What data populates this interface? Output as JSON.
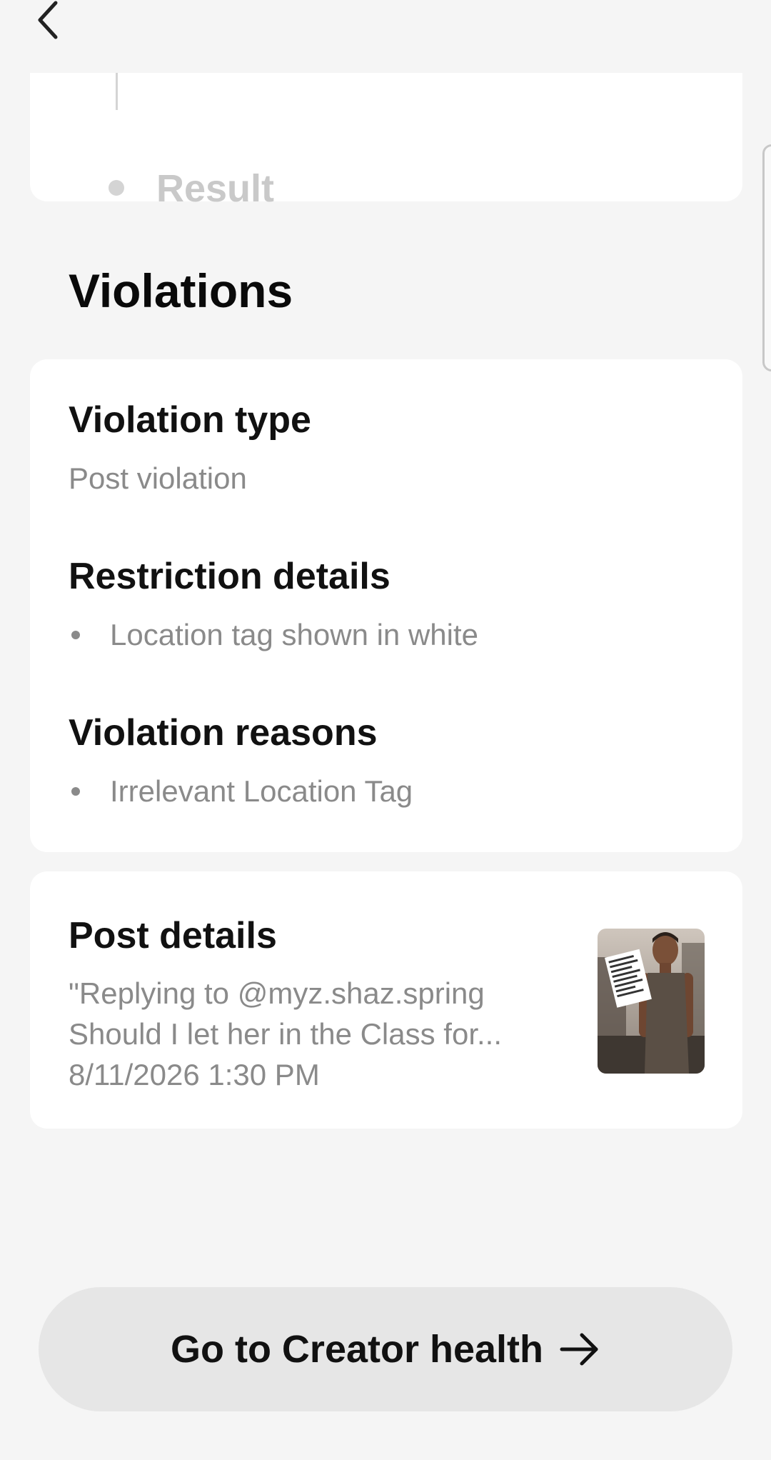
{
  "header": {
    "back_icon": "chevron-left-icon"
  },
  "progress": {
    "step_label": "Result"
  },
  "section": {
    "title": "Violations"
  },
  "violation": {
    "type_label": "Violation type",
    "type_value": "Post violation",
    "restriction_label": "Restriction details",
    "restriction_items": [
      "Location tag shown in white"
    ],
    "reasons_label": "Violation reasons",
    "reason_items": [
      "Irrelevant Location Tag"
    ]
  },
  "post": {
    "title": "Post details",
    "caption_line1": "\"Replying to @myz.shaz.spring",
    "caption_line2": "Should I let her in the Class for...",
    "timestamp": "8/11/2026 1:30 PM",
    "thumbnail_icon": "post-thumbnail-image"
  },
  "cta": {
    "label": "Go to Creator health",
    "icon": "arrow-right-icon"
  },
  "colors": {
    "background": "#f5f5f5",
    "card": "#ffffff",
    "muted_text": "#8a8a8a",
    "button_bg": "#e6e6e6"
  }
}
